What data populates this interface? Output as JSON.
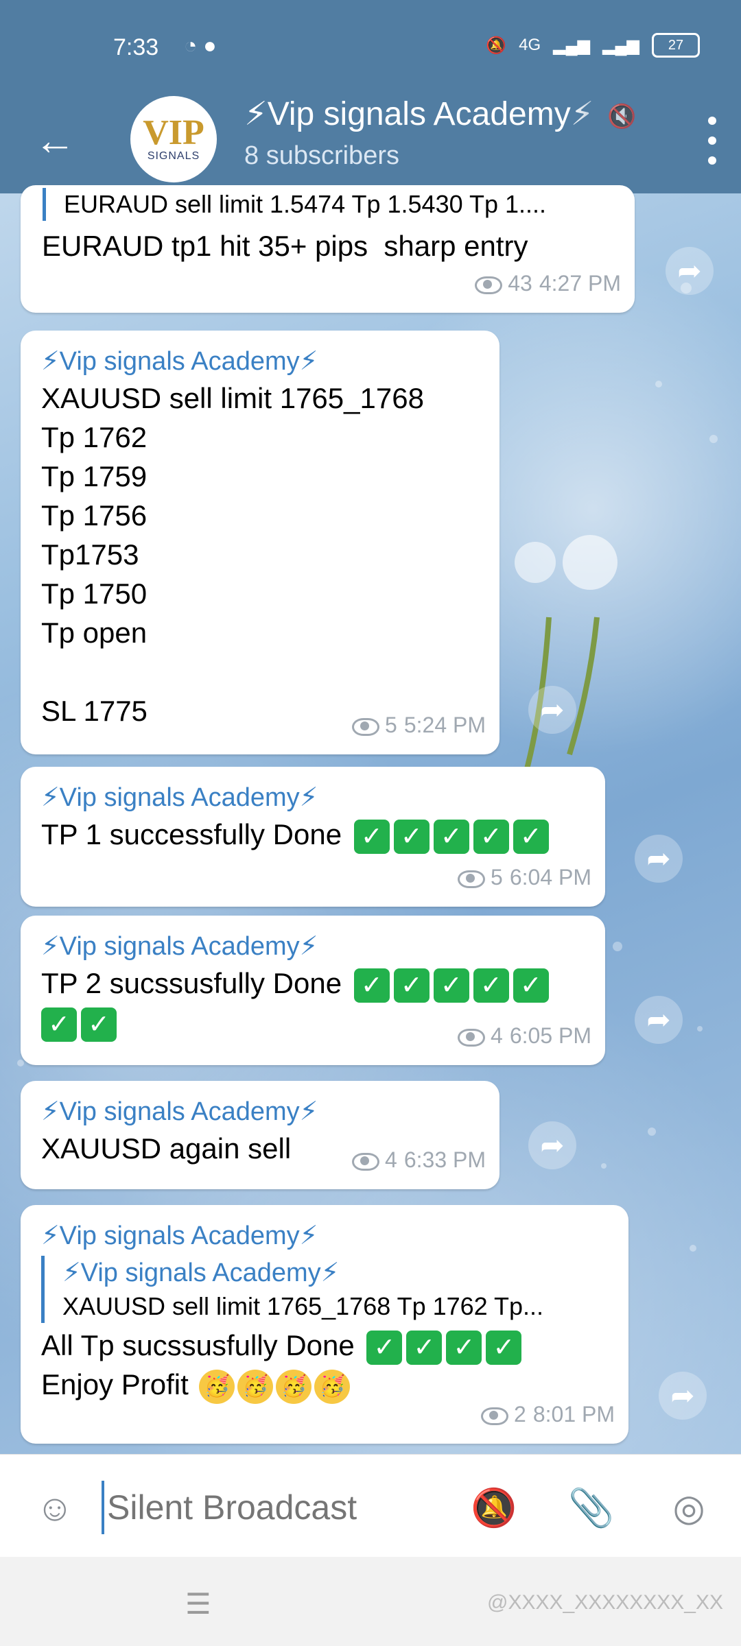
{
  "status_bar": {
    "time": "7:33",
    "battery": "27",
    "network": "4G"
  },
  "header": {
    "back_icon": "back-arrow-icon",
    "avatar_text_main": "VIP",
    "avatar_text_sub": "SIGNALS",
    "title": "⚡Vip signals Academy⚡",
    "subtitle": "8 subscribers"
  },
  "messages": [
    {
      "quote_text": "EURAUD sell limit 1.5474  Tp 1.5430 Tp 1....",
      "lines": [
        "EURAUD tp1 hit 35+ pips  sharp entry"
      ],
      "views": "43",
      "time": "4:27 PM"
    },
    {
      "sender": "⚡Vip signals Academy⚡",
      "lines": [
        "XAUUSD sell limit 1765_1768",
        "Tp 1762",
        "Tp 1759",
        "Tp 1756",
        "Tp1753",
        "Tp 1750",
        "Tp open",
        "",
        "SL 1775"
      ],
      "views": "5",
      "time": "5:24 PM"
    },
    {
      "sender": "⚡Vip signals Academy⚡",
      "text": "TP 1 successfully Done",
      "checks": 5,
      "views": "5",
      "time": "6:04 PM"
    },
    {
      "sender": "⚡Vip signals Academy⚡",
      "text": "TP 2 sucssusfully Done",
      "checks": 5,
      "checks_line2": 2,
      "views": "4",
      "time": "6:05 PM"
    },
    {
      "sender": "⚡Vip signals Academy⚡",
      "text": "XAUUSD again sell",
      "views": "4",
      "time": "6:33 PM"
    },
    {
      "sender": "⚡Vip signals Academy⚡",
      "quote_sender": "⚡Vip signals Academy⚡",
      "quote_text": "XAUUSD sell limit 1765_1768 Tp 1762 Tp...",
      "text": "All Tp sucssusfully Done",
      "checks": 4,
      "text2": "Enjoy Profit",
      "emojis": 4,
      "views": "2",
      "time": "8:01 PM"
    }
  ],
  "input": {
    "placeholder": "Silent Broadcast"
  },
  "nav": {
    "watermark": "@XXXX_XXXXXXXX_XX"
  }
}
